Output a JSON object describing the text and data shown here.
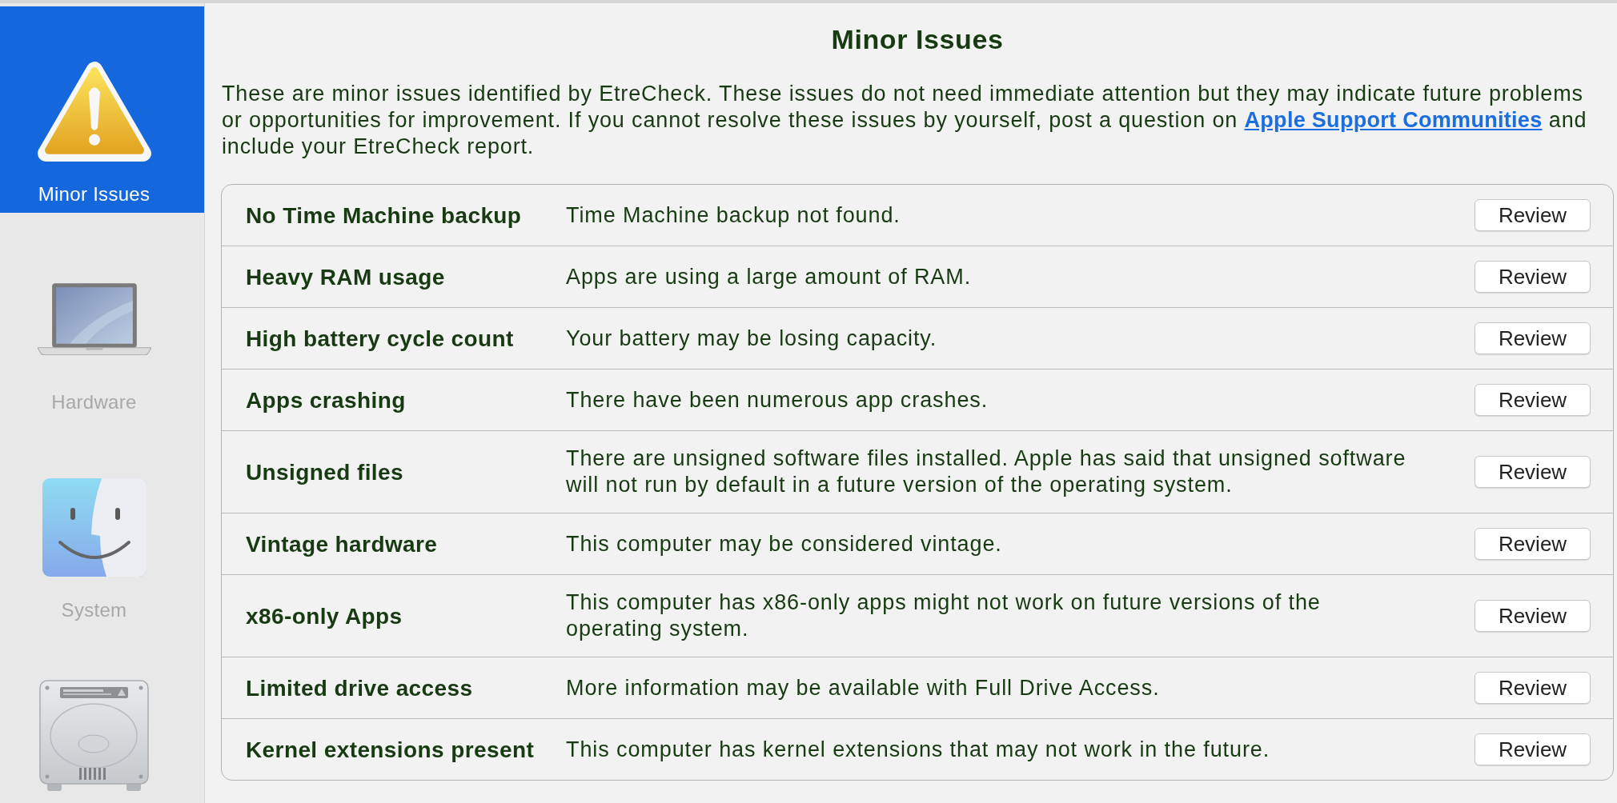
{
  "sidebar": {
    "items": [
      {
        "label": "Minor Issues",
        "selected": true
      },
      {
        "label": "Hardware",
        "selected": false
      },
      {
        "label": "System",
        "selected": false
      },
      {
        "selected": false
      }
    ]
  },
  "content": {
    "title": "Minor Issues",
    "intro": {
      "text": "These are minor issues identified by EtreCheck. These issues do not need immediate attention but they may indicate future problems or opportunities for improvement. If you cannot resolve these issues by yourself, post a question on",
      "link": "Apple Support Communities",
      "text_after": "and include your EtreCheck report."
    },
    "issues": [
      {
        "title": "No Time Machine backup",
        "description": "Time Machine backup not found.",
        "button": "Review"
      },
      {
        "title": "Heavy RAM usage",
        "description": "Apps are using a large amount of RAM.",
        "button": "Review"
      },
      {
        "title": "High battery cycle count",
        "description": "Your battery may be losing capacity.",
        "button": "Review"
      },
      {
        "title": "Apps crashing",
        "description": "There have been numerous app crashes.",
        "button": "Review"
      },
      {
        "title": "Unsigned files",
        "description": "There are unsigned software files installed. Apple has said that unsigned software will not run by default in a future version of the operating system.",
        "button": "Review"
      },
      {
        "title": "Vintage hardware",
        "description": "This computer may be considered vintage.",
        "button": "Review"
      },
      {
        "title": "x86-only Apps",
        "description": "This computer has x86-only apps might not work on future versions of the operating system.",
        "button": "Review"
      },
      {
        "title": "Limited drive access",
        "description": "More information may be available with Full Drive Access.",
        "button": "Review"
      },
      {
        "title": "Kernel extensions present",
        "description": "This computer has kernel extensions that may not work in the future.",
        "button": "Review"
      }
    ]
  }
}
